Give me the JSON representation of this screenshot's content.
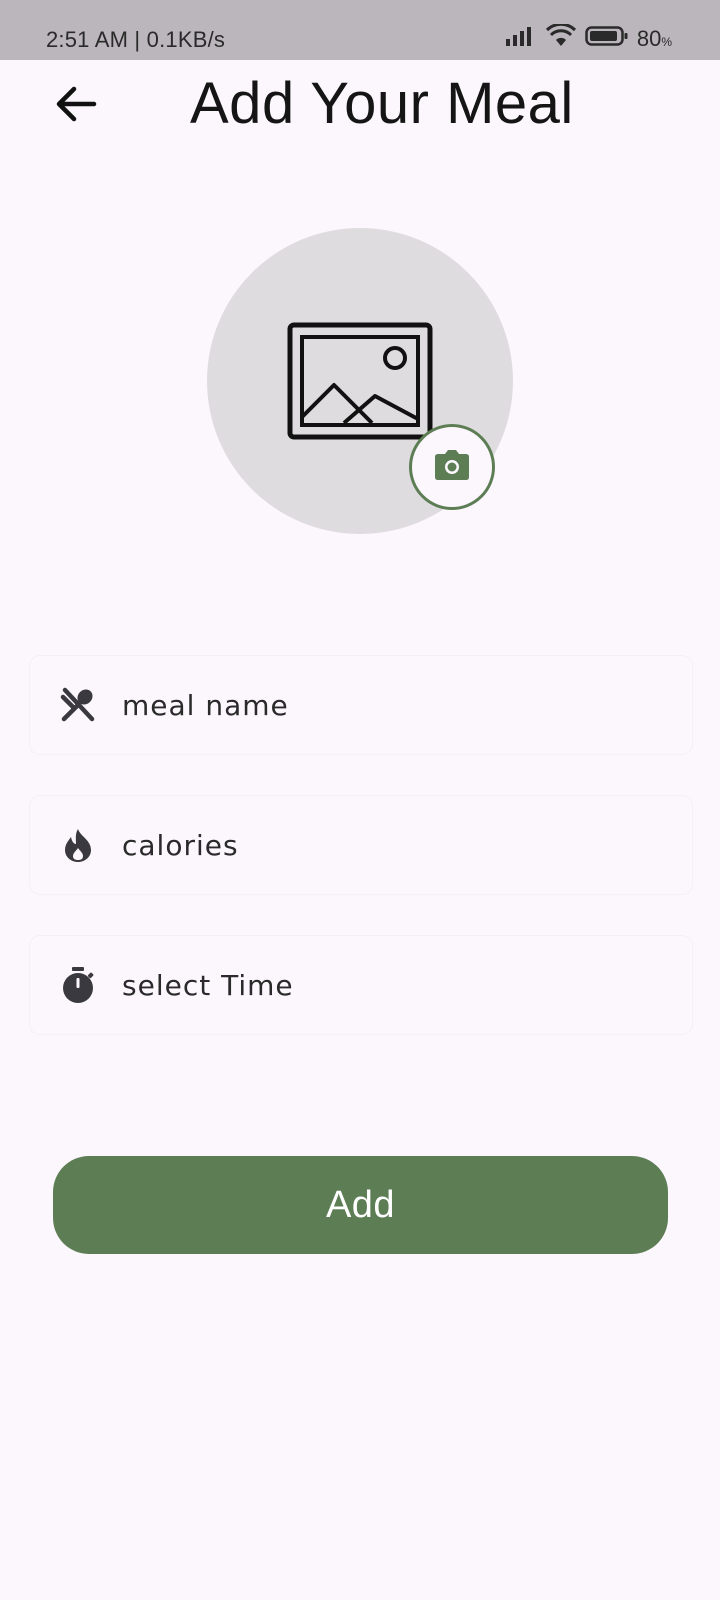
{
  "status_bar": {
    "time_speed": "2:51 AM | 0.1KB/s",
    "battery": "80",
    "battery_unit": "%",
    "icons": [
      "signal-icon",
      "wifi-icon",
      "battery-icon"
    ]
  },
  "header": {
    "title": "Add Your Meal",
    "back_icon": "arrow-back-icon"
  },
  "image_picker": {
    "placeholder_icon": "image-placeholder-icon",
    "camera_icon": "camera-icon"
  },
  "form": {
    "meal_name": {
      "placeholder": "meal name",
      "value": "",
      "icon": "utensils-icon"
    },
    "calories": {
      "placeholder": "calories",
      "value": "",
      "icon": "flame-icon"
    },
    "time": {
      "placeholder": "select Time",
      "value": "",
      "icon": "stopwatch-icon"
    }
  },
  "actions": {
    "add_label": "Add"
  },
  "colors": {
    "accent": "#5d7e55",
    "background": "#fcf6fd",
    "status_bar": "#bab6bb",
    "picker_circle": "#dfdcdf"
  }
}
